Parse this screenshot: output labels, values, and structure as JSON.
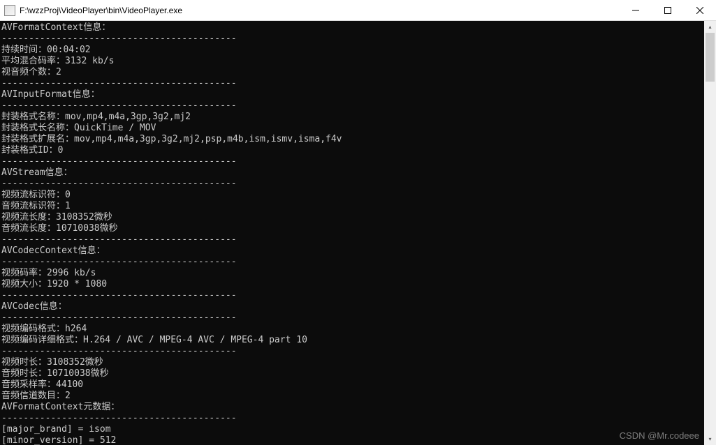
{
  "window": {
    "title": "F:\\wzzProj\\VideoPlayer\\bin\\VideoPlayer.exe"
  },
  "console": {
    "sections": {
      "avformat_header": "AVFormatContext信息：",
      "dash": "-------------------------------------------",
      "duration": "持续时间：00:04:02",
      "bitrate": "平均混合码率：3132 kb/s",
      "streamcount": "视音频个数：2",
      "avinput_header": "AVInputFormat信息：",
      "muxname": "封装格式名称：mov,mp4,m4a,3gp,3g2,mj2",
      "muxlong": "封装格式长名称：QuickTime / MOV",
      "muxext": "封装格式扩展名：mov,mp4,m4a,3gp,3g2,mj2,psp,m4b,ism,ismv,isma,f4v",
      "muxid": "封装格式ID：0",
      "avstream_header": "AVStream信息：",
      "vid_idx": "视频流标识符：0",
      "aud_idx": "音频流标识符：1",
      "vid_len": "视频流长度：3108352微秒",
      "aud_len": "音频流长度：10710038微秒",
      "avcodecctx_header": "AVCodecContext信息：",
      "vid_br": "视频码率：2996 kb/s",
      "vid_size": "视频大小：1920 * 1080",
      "avcodec_header": "AVCodec信息：",
      "venc": "视频编码格式：h264",
      "venc_long": "视频编码详细格式：H.264 / AVC / MPEG-4 AVC / MPEG-4 part 10",
      "vdur": "视频时长：3108352微秒",
      "adur": "音频时长：10710038微秒",
      "asr": "音频采样率：44100",
      "ach": "音频信道数目：2",
      "meta_header": "AVFormatContext元数据：",
      "meta1": "[major_brand] = isom",
      "meta2": "[minor_version] = 512"
    }
  },
  "watermark": "CSDN @Mr.codeee"
}
